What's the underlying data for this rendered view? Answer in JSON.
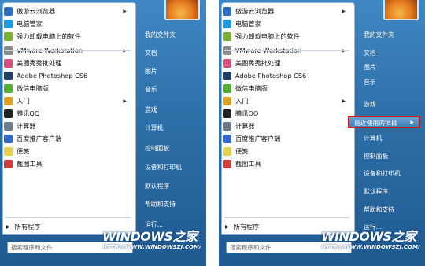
{
  "colors": {
    "accent": "#2d6fa8",
    "highlight_border": "#dd1111"
  },
  "left": {
    "programs": [
      {
        "label": "傲游云浏览器",
        "icon": "maxthon-icon",
        "color": "#2c6fc6",
        "arrow": true
      },
      {
        "label": "电脑管家",
        "icon": "shield-icon",
        "color": "#1e9be0",
        "arrow": false
      },
      {
        "label": "强力卸载电脑上的软件",
        "icon": "uninstall-icon",
        "color": "#7ab030",
        "arrow": false
      },
      {
        "label": "VMware Workstation",
        "icon": "vmware-icon",
        "color": "#8a8a8a",
        "arrow": true
      },
      {
        "label": "美图秀秀批处理",
        "icon": "meitu-icon",
        "color": "#d84f7a",
        "arrow": false
      },
      {
        "label": "Adobe Photoshop CS6",
        "icon": "photoshop-icon",
        "color": "#1f3e63",
        "arrow": false
      },
      {
        "label": "微信电脑版",
        "icon": "wechat-icon",
        "color": "#52b230",
        "arrow": false
      },
      {
        "label": "入门",
        "icon": "getting-started-icon",
        "color": "#e0a020",
        "arrow": true
      },
      {
        "label": "腾讯QQ",
        "icon": "qq-icon",
        "color": "#222222",
        "arrow": false
      },
      {
        "label": "计算器",
        "icon": "calculator-icon",
        "color": "#6d7b8a",
        "arrow": false
      },
      {
        "label": "百度推广客户端",
        "icon": "baidu-icon",
        "color": "#3366cc",
        "arrow": false
      },
      {
        "label": "便笺",
        "icon": "sticky-notes-icon",
        "color": "#e6d24a",
        "arrow": false
      },
      {
        "label": "截图工具",
        "icon": "snipping-tool-icon",
        "color": "#d13b3b",
        "arrow": false
      }
    ],
    "all_programs": "所有程序",
    "search_placeholder": "搜索程序和文件",
    "links": [
      "我的文件夹",
      "文档",
      "图片",
      "音乐",
      "游戏",
      "计算机",
      "控制面板",
      "设备和打印机",
      "默认程序",
      "帮助和支持",
      "运行..."
    ]
  },
  "right": {
    "programs": [
      {
        "label": "傲游云浏览器",
        "icon": "maxthon-icon",
        "color": "#2c6fc6",
        "arrow": true
      },
      {
        "label": "电脑管家",
        "icon": "shield-icon",
        "color": "#1e9be0",
        "arrow": false
      },
      {
        "label": "强力卸载电脑上的软件",
        "icon": "uninstall-icon",
        "color": "#7ab030",
        "arrow": false
      },
      {
        "label": "VMware Workstation",
        "icon": "vmware-icon",
        "color": "#8a8a8a",
        "arrow": true
      },
      {
        "label": "美图秀秀批处理",
        "icon": "meitu-icon",
        "color": "#d84f7a",
        "arrow": false
      },
      {
        "label": "Adobe Photoshop CS6",
        "icon": "photoshop-icon",
        "color": "#1f3e63",
        "arrow": false
      },
      {
        "label": "微信电脑版",
        "icon": "wechat-icon",
        "color": "#52b230",
        "arrow": false
      },
      {
        "label": "入门",
        "icon": "getting-started-icon",
        "color": "#e0a020",
        "arrow": true
      },
      {
        "label": "腾讯QQ",
        "icon": "qq-icon",
        "color": "#222222",
        "arrow": false
      },
      {
        "label": "计算器",
        "icon": "calculator-icon",
        "color": "#6d7b8a",
        "arrow": false
      },
      {
        "label": "百度推广客户端",
        "icon": "baidu-icon",
        "color": "#3366cc",
        "arrow": false
      },
      {
        "label": "便笺",
        "icon": "sticky-notes-icon",
        "color": "#e6d24a",
        "arrow": false
      },
      {
        "label": "截图工具",
        "icon": "snipping-tool-icon",
        "color": "#d13b3b",
        "arrow": false
      }
    ],
    "all_programs": "所有程序",
    "search_placeholder": "搜索程序和文件",
    "links": [
      "我的文件夹",
      "文档",
      "图片",
      "音乐",
      "游戏",
      "最近使用的项目",
      "计算机",
      "控制面板",
      "设备和打印机",
      "默认程序",
      "帮助和支持",
      "运行..."
    ],
    "highlighted_link": "最近使用的项目"
  },
  "watermark": {
    "brand": "WINDOWS之家",
    "url": "HTTP://WWW.WINDOWSZJ.COM/"
  }
}
